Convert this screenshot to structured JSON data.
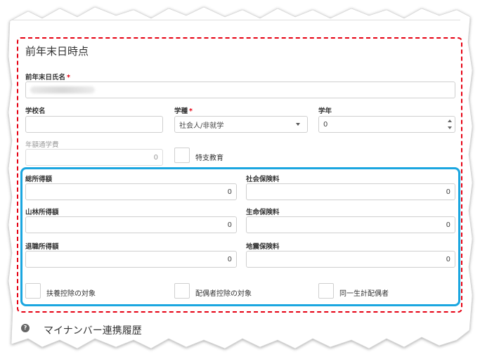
{
  "section": {
    "title": "前年末日時点"
  },
  "fields": {
    "name": {
      "label": "前年末日氏名",
      "required": "*"
    },
    "school": {
      "label": "学校名",
      "value": ""
    },
    "school_type": {
      "label": "学種",
      "required": "*",
      "value": "社会人/非就学"
    },
    "grade": {
      "label": "学年",
      "value": "0"
    },
    "annual_tuition": {
      "label": "年額通学費",
      "value": "0"
    },
    "special_education": {
      "label": "特支教育"
    },
    "total_income": {
      "label": "総所得額",
      "value": "0"
    },
    "social_insurance": {
      "label": "社会保険料",
      "value": "0"
    },
    "forest_income": {
      "label": "山林所得額",
      "value": "0"
    },
    "life_insurance": {
      "label": "生命保険料",
      "value": "0"
    },
    "retirement_income": {
      "label": "退職所得額",
      "value": "0"
    },
    "earthquake_insurance": {
      "label": "地震保険料",
      "value": "0"
    }
  },
  "checkboxes": {
    "dependent_deduction": "扶養控除の対象",
    "spouse_deduction": "配偶者控除の対象",
    "same_household_spouse": "同一生計配偶者"
  },
  "next_section": {
    "title": "マイナンバー連携履歴",
    "icon": "help-icon",
    "icon_glyph": "?"
  },
  "colors": {
    "highlight_red": "#e60012",
    "highlight_blue": "#1aa6e0"
  }
}
